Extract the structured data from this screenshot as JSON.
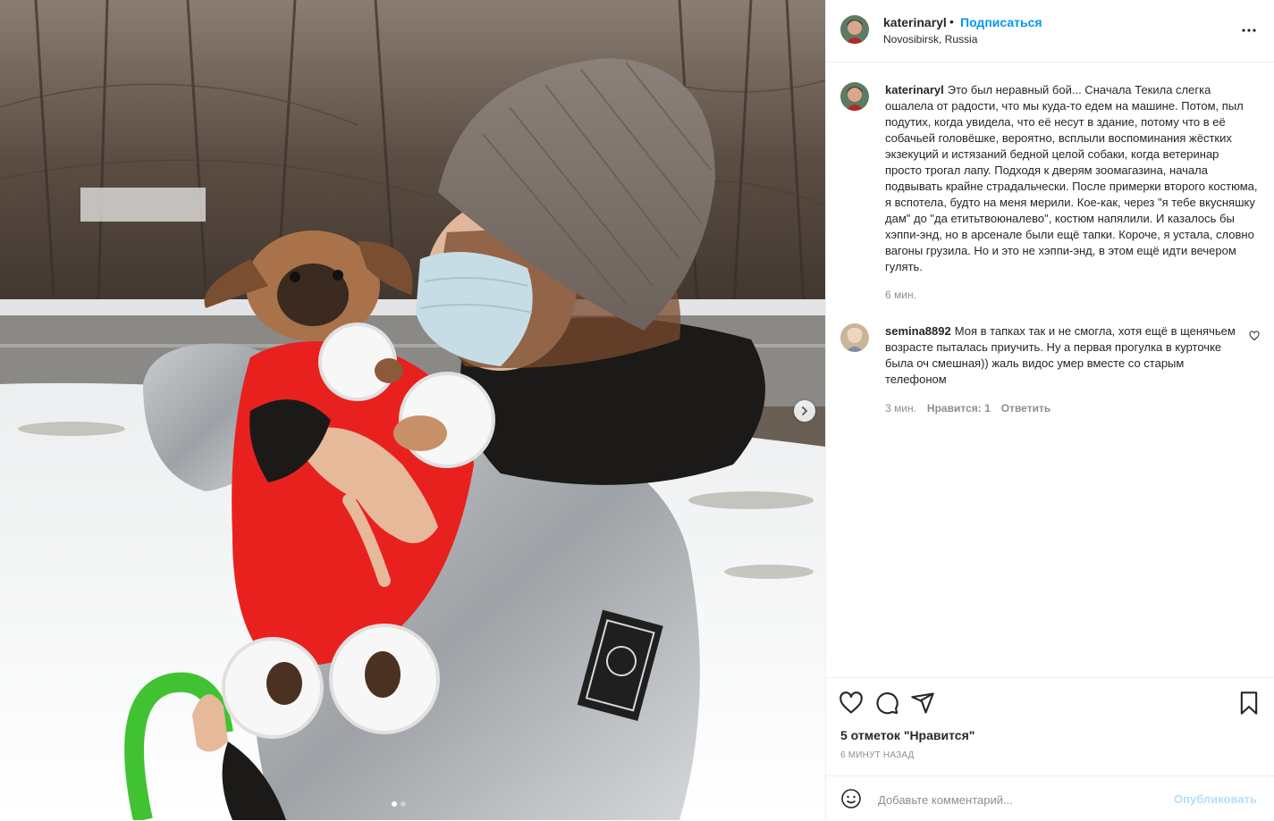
{
  "post": {
    "author": "katerinaryl",
    "separator": "•",
    "follow_label": "Подписаться",
    "location": "Novosibirsk, Russia",
    "more_icon": "more-horizontal-icon"
  },
  "caption": {
    "user": "katerinaryl",
    "text": "Это был неравный бой... Сначала Текила слегка ошалела от радости, что мы куда-то едем на машине. Потом, пыл подутих, когда увидела, что её несут в здание, потому что в её собачьей головёшке, вероятно, всплыли воспоминания жёстких экзекуций и истязаний бедной целой собаки, когда ветеринар просто трогал лапу. Подходя к дверям зоомагазина, начала подвывать крайне страдальчески. После примерки второго костюма, я вспотела, будто на меня мерили. Кое-как, через \"я тебе вкусняшку дам\" до \"да етитьтвоюналево\", костюм напялили. И казалось бы хэппи-энд, но в арсенале были ещё тапки. Короче, я устала, словно вагоны грузила. Но и это не хэппи-энд, в этом ещё идти вечером гулять.",
    "time": "6 мин."
  },
  "comment": {
    "user": "semina8892",
    "text": "Моя в тапках так и не смогла, хотя ещё в щенячьем возрасте пыталась приучить. Ну а первая прогулка в курточке была оч смешная)) жаль видос умер вместе со старым телефоном",
    "time": "3 мин.",
    "likes": "Нравится: 1",
    "reply": "Ответить"
  },
  "actions": {
    "icons": [
      "heart-icon",
      "comment-icon",
      "share-icon",
      "bookmark-icon"
    ],
    "likes_count": "5 отметок \"Нравится\"",
    "posted_ago": "6 минут назад"
  },
  "add_comment": {
    "placeholder": "Добавьте комментарий...",
    "publish_label": "Опубликовать"
  },
  "carousel": {
    "total": 2,
    "current": 1
  },
  "colors": {
    "link": "#0095f6",
    "publish_disabled": "#b2dffc",
    "muted": "#8e8e8e",
    "text": "#262626"
  }
}
